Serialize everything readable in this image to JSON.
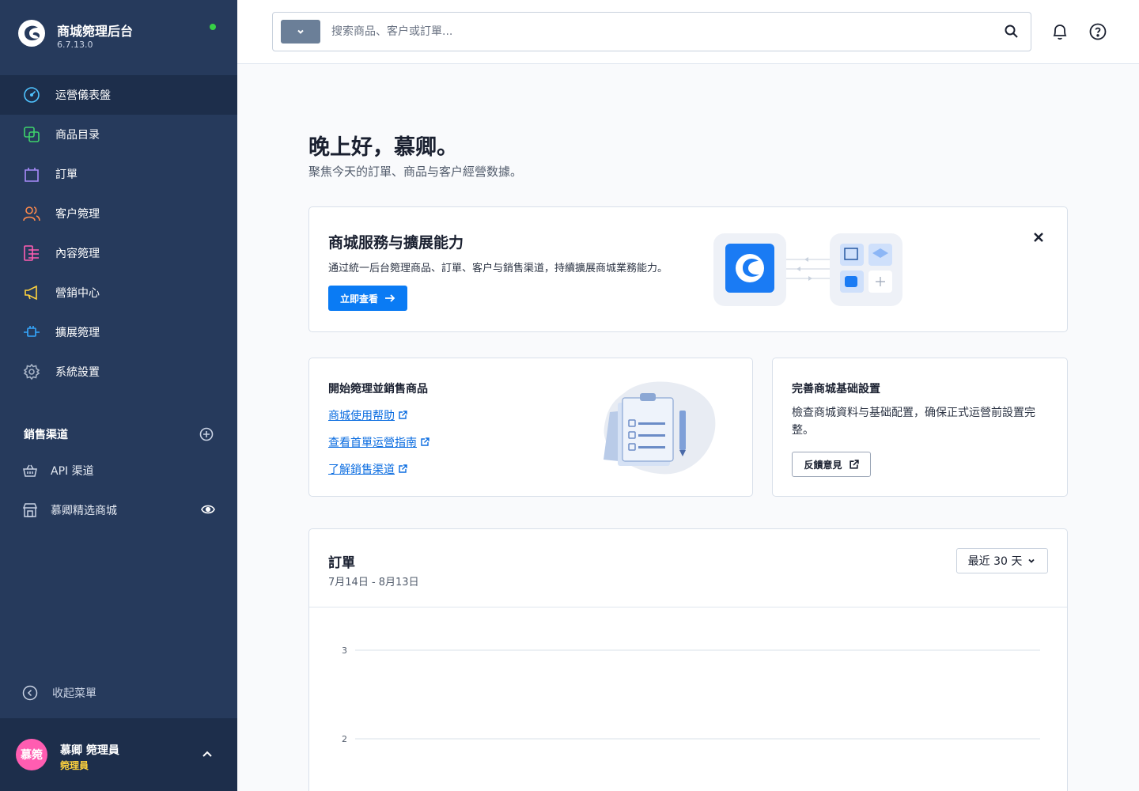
{
  "app": {
    "title": "商城箢理后台",
    "version": "6.7.13.0"
  },
  "nav": [
    {
      "label": "运營儀表盤",
      "icon": "dashboard-icon",
      "color": "#4fc3ff"
    },
    {
      "label": "商品目录",
      "icon": "products-icon",
      "color": "#3ed26b"
    },
    {
      "label": "訂單",
      "icon": "orders-bag-icon",
      "color": "#a78bfa"
    },
    {
      "label": "客户箢理",
      "icon": "customers-icon",
      "color": "#ff8a4c"
    },
    {
      "label": "內容箢理",
      "icon": "content-icon",
      "color": "#ff5db1"
    },
    {
      "label": "營銷中心",
      "icon": "marketing-megaphone-icon",
      "color": "#ffd33d"
    },
    {
      "label": "擴展箢理",
      "icon": "extensions-icon",
      "color": "#35a8ff"
    },
    {
      "label": "系統設置",
      "icon": "settings-gear-icon",
      "color": "#a7b3c6"
    }
  ],
  "channels": {
    "title": "銷售渠道",
    "items": [
      {
        "label": "API 渠道",
        "icon": "basket-icon"
      },
      {
        "label": "慕卿精选商城",
        "icon": "storefront-icon"
      }
    ]
  },
  "collapse_label": "收起菜單",
  "user": {
    "avatar_text": "慕箢",
    "name": "慕卿 箢理員",
    "role": "箢理員"
  },
  "search": {
    "placeholder": "搜索商品、客户或訂單..."
  },
  "greeting": {
    "title": "晚上好，慕卿。",
    "subtitle": "聚焦今天的訂單、商品与客户經營数據。"
  },
  "promo": {
    "title": "商城服務与擴展能力",
    "description": "通过統一后台箢理商品、訂單、客户与銷售渠道，持續擴展商城業務能力。",
    "button": "立即查看"
  },
  "start_card": {
    "title": "開始箢理並銷售商品",
    "links": [
      "商城使用帮助",
      "查看首單运營指南",
      "了解銷售渠道"
    ]
  },
  "setup_card": {
    "title": "完善商城基础設置",
    "description": "檢查商城資料与基础配置，确保正式运營前設置完整。",
    "button": "反饋意見"
  },
  "orders": {
    "title": "訂單",
    "range": "7月14日 - 8月13日",
    "period_select": "最近 30 天"
  },
  "chart_data": {
    "type": "line",
    "title": "",
    "xlabel": "",
    "ylabel": "",
    "y_ticks": [
      3,
      2
    ],
    "grid": true,
    "series": []
  },
  "colors": {
    "sidebar_bg": "#263a5c",
    "sidebar_active": "#1d2e4b",
    "accent": "#0a7bf4",
    "status_online": "#37d046",
    "avatar_bg": "#ff5db1",
    "role_text": "#ffd33d"
  }
}
